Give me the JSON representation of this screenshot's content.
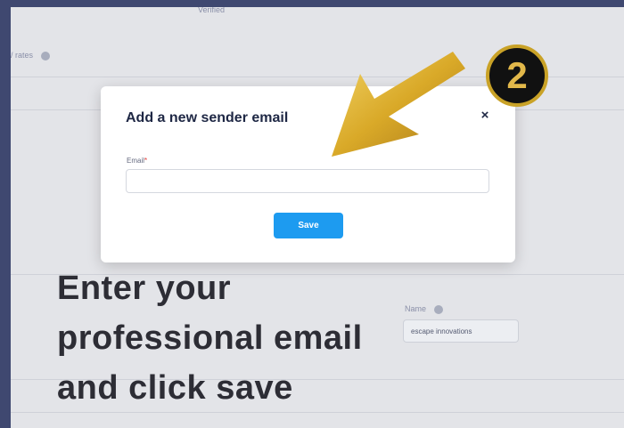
{
  "background": {
    "verified_label": "Verified",
    "rates_label": "/ rates",
    "name_label": "Name",
    "name_value": "escape innovations"
  },
  "modal": {
    "title": "Add a new sender email",
    "close_symbol": "×",
    "email_label": "Email",
    "required_marker": "*",
    "email_value": "",
    "save_label": "Save"
  },
  "overlay": {
    "step_number": "2",
    "instruction_lines": [
      "Enter your",
      "professional email",
      "and click save"
    ]
  },
  "colors": {
    "primary_button": "#1d9bf0",
    "badge_ring": "#c9a227",
    "arrow_gold": "#d9b13b"
  }
}
